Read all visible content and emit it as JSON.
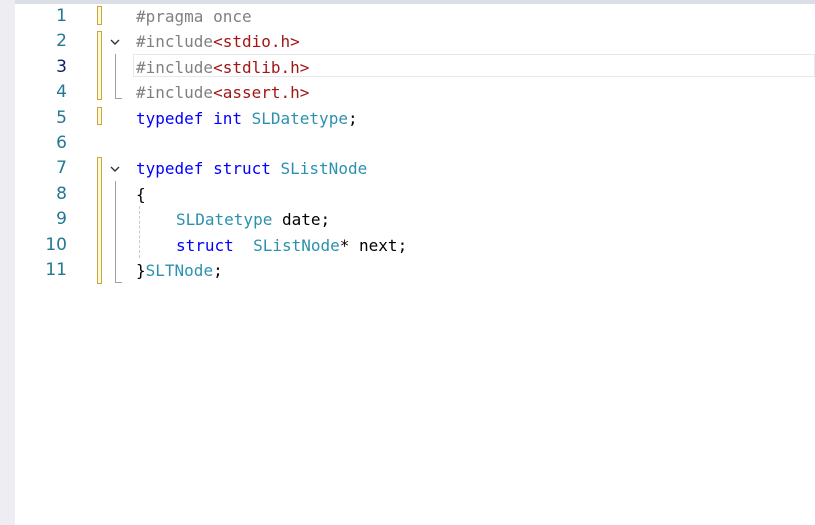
{
  "editor": {
    "current_line": 3,
    "lines": [
      {
        "number": "1",
        "tokens": [
          {
            "t": "#pragma once",
            "c": "pre"
          }
        ]
      },
      {
        "number": "2",
        "tokens": [
          {
            "t": "#include",
            "c": "pre"
          },
          {
            "t": "<stdio.h>",
            "c": "str"
          }
        ]
      },
      {
        "number": "3",
        "tokens": [
          {
            "t": "#include",
            "c": "pre"
          },
          {
            "t": "<stdlib.h>",
            "c": "str"
          }
        ]
      },
      {
        "number": "4",
        "tokens": [
          {
            "t": "#include",
            "c": "pre"
          },
          {
            "t": "<assert.h>",
            "c": "str"
          }
        ]
      },
      {
        "number": "5",
        "tokens": [
          {
            "t": "typedef",
            "c": "kw"
          },
          {
            "t": " ",
            "c": "punc"
          },
          {
            "t": "int",
            "c": "kw"
          },
          {
            "t": " ",
            "c": "punc"
          },
          {
            "t": "SLDatetype",
            "c": "type"
          },
          {
            "t": ";",
            "c": "punc"
          }
        ]
      },
      {
        "number": "6",
        "tokens": []
      },
      {
        "number": "7",
        "tokens": [
          {
            "t": "typedef",
            "c": "kw"
          },
          {
            "t": " ",
            "c": "punc"
          },
          {
            "t": "struct",
            "c": "kw"
          },
          {
            "t": " ",
            "c": "punc"
          },
          {
            "t": "SListNode",
            "c": "type"
          }
        ]
      },
      {
        "number": "8",
        "tokens": [
          {
            "t": "{",
            "c": "punc"
          }
        ]
      },
      {
        "number": "9",
        "indent": true,
        "tokens": [
          {
            "t": "SLDatetype",
            "c": "type"
          },
          {
            "t": " date;",
            "c": "var"
          }
        ]
      },
      {
        "number": "10",
        "indent": true,
        "tokens": [
          {
            "t": "struct",
            "c": "kw"
          },
          {
            "t": "  ",
            "c": "punc"
          },
          {
            "t": "SListNode",
            "c": "type"
          },
          {
            "t": "* next;",
            "c": "var"
          }
        ]
      },
      {
        "number": "11",
        "tokens": [
          {
            "t": "}",
            "c": "punc"
          },
          {
            "t": "SLTNode",
            "c": "type"
          },
          {
            "t": ";",
            "c": "punc"
          }
        ]
      }
    ],
    "folds": [
      {
        "line": 2,
        "icon": "chevron-down-icon"
      },
      {
        "line": 7,
        "icon": "chevron-down-icon"
      }
    ],
    "colors": {
      "preprocessor": "#808080",
      "string": "#a31515",
      "keyword": "#0000ff",
      "type": "#2b91af",
      "line_number": "#237893",
      "change_marker": "#c8a840"
    }
  }
}
